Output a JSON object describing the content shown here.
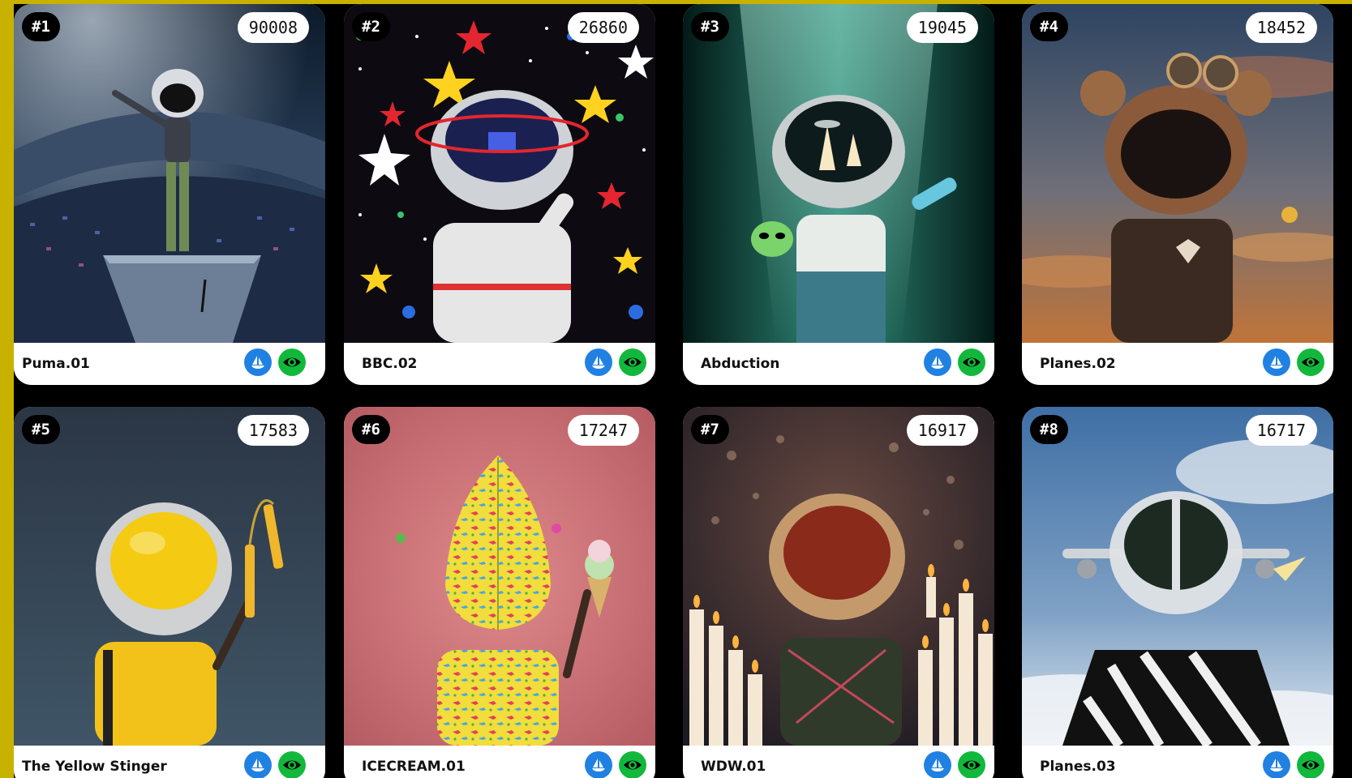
{
  "gallery": {
    "cards": [
      {
        "rank": "#1",
        "score": "90008",
        "name": "Puma.01"
      },
      {
        "rank": "#2",
        "score": "26860",
        "name": "BBC.02"
      },
      {
        "rank": "#3",
        "score": "19045",
        "name": "Abduction"
      },
      {
        "rank": "#4",
        "score": "18452",
        "name": "Planes.02"
      },
      {
        "rank": "#5",
        "score": "17583",
        "name": "The Yellow Stinger"
      },
      {
        "rank": "#6",
        "score": "17247",
        "name": "ICECREAM.01"
      },
      {
        "rank": "#7",
        "score": "16917",
        "name": "WDW.01"
      },
      {
        "rank": "#8",
        "score": "16717",
        "name": "Planes.03"
      }
    ],
    "colors": {
      "page_border": "#c9b100",
      "opensea_blue": "#2081e2",
      "view_green": "#12b83c"
    },
    "icons": {
      "marketplace": "sailboat-icon",
      "view": "eye-icon"
    }
  }
}
